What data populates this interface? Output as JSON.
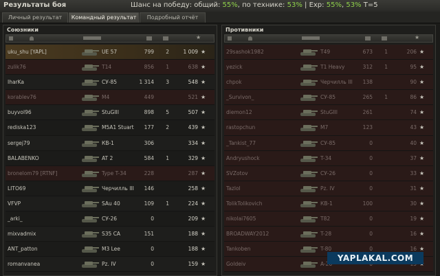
{
  "header": {
    "title": "Результаты боя",
    "chance_label": "Шанс на победу: общий:",
    "chance_overall": "55%",
    "chance_tech_label": ", по технике:",
    "chance_tech": "53%",
    "exp_label": " | Exp:",
    "exp_1": "55%",
    "sep": ",",
    "exp_2": "53%",
    "tier": "T=5"
  },
  "tabs": [
    {
      "label": "Личный результат",
      "active": false
    },
    {
      "label": "Командный результат",
      "active": true
    },
    {
      "label": "Подробный отчёт",
      "active": false
    }
  ],
  "allies": {
    "title": "Союзники",
    "rows": [
      {
        "name": "uku_shu [YAPL]",
        "tank": "UE 57",
        "damage": "799",
        "kills": "2",
        "xp": "1 009",
        "state": "hl"
      },
      {
        "name": "zulik76",
        "tank": "T14",
        "damage": "856",
        "kills": "1",
        "xp": "638",
        "state": "dead"
      },
      {
        "name": "IharKa",
        "tank": "СУ-85",
        "damage": "1 314",
        "kills": "3",
        "xp": "548",
        "state": ""
      },
      {
        "name": "korablev76",
        "tank": "M4",
        "damage": "449",
        "kills": "",
        "xp": "521",
        "state": "dead"
      },
      {
        "name": "buyvol96",
        "tank": "StuGIII",
        "damage": "898",
        "kills": "5",
        "xp": "507",
        "state": ""
      },
      {
        "name": "rediska123",
        "tank": "M5A1 Stuart",
        "damage": "177",
        "kills": "2",
        "xp": "439",
        "state": ""
      },
      {
        "name": "sergej79",
        "tank": "КВ-1",
        "damage": "306",
        "kills": "",
        "xp": "334",
        "state": ""
      },
      {
        "name": "BALABENKO",
        "tank": "AT 2",
        "damage": "584",
        "kills": "1",
        "xp": "329",
        "state": ""
      },
      {
        "name": "bronelom79 [RTNF]",
        "tank": "Type T-34",
        "damage": "228",
        "kills": "",
        "xp": "287",
        "state": "dead"
      },
      {
        "name": "LITO69",
        "tank": "Черчилль III",
        "damage": "146",
        "kills": "",
        "xp": "258",
        "state": ""
      },
      {
        "name": "VFVP",
        "tank": "SAu 40",
        "damage": "109",
        "kills": "1",
        "xp": "224",
        "state": ""
      },
      {
        "name": "_arki_",
        "tank": "СУ-26",
        "damage": "0",
        "kills": "",
        "xp": "209",
        "state": ""
      },
      {
        "name": "mixvadmix",
        "tank": "S35 CA",
        "damage": "151",
        "kills": "",
        "xp": "188",
        "state": ""
      },
      {
        "name": "ANT_patton",
        "tank": "M3 Lee",
        "damage": "0",
        "kills": "",
        "xp": "188",
        "state": ""
      },
      {
        "name": "romanvanea",
        "tank": "Pz. IV",
        "damage": "0",
        "kills": "",
        "xp": "159",
        "state": ""
      }
    ]
  },
  "enemies": {
    "title": "Противники",
    "rows": [
      {
        "name": "29sashok1982",
        "tank": "T49",
        "damage": "673",
        "kills": "1",
        "xp": "206",
        "state": "dead"
      },
      {
        "name": "yezick",
        "tank": "T1 Heavy",
        "damage": "312",
        "kills": "1",
        "xp": "95",
        "state": "dead"
      },
      {
        "name": "chpok",
        "tank": "Черчилль III",
        "damage": "138",
        "kills": "",
        "xp": "90",
        "state": "dead"
      },
      {
        "name": "_Survivon_",
        "tank": "СУ-85",
        "damage": "265",
        "kills": "1",
        "xp": "86",
        "state": "dead"
      },
      {
        "name": "diemon12",
        "tank": "StuGIII",
        "damage": "261",
        "kills": "",
        "xp": "74",
        "state": "dead"
      },
      {
        "name": "rastopchun",
        "tank": "M7",
        "damage": "123",
        "kills": "",
        "xp": "43",
        "state": "dead"
      },
      {
        "name": "_Tankist_77",
        "tank": "СУ-85",
        "damage": "0",
        "kills": "",
        "xp": "40",
        "state": "dead"
      },
      {
        "name": "Andryushock",
        "tank": "T-34",
        "damage": "0",
        "kills": "",
        "xp": "37",
        "state": "dead"
      },
      {
        "name": "SVZotov",
        "tank": "СУ-26",
        "damage": "0",
        "kills": "",
        "xp": "33",
        "state": "dead"
      },
      {
        "name": "Tazlol",
        "tank": "Pz. IV",
        "damage": "0",
        "kills": "",
        "xp": "31",
        "state": "dead"
      },
      {
        "name": "TolikTolikovich",
        "tank": "КВ-1",
        "damage": "100",
        "kills": "",
        "xp": "30",
        "state": "dead"
      },
      {
        "name": "nikolai7605",
        "tank": "T82",
        "damage": "0",
        "kills": "",
        "xp": "19",
        "state": "dead"
      },
      {
        "name": "BROADWAY2012",
        "tank": "T-28",
        "damage": "0",
        "kills": "",
        "xp": "16",
        "state": "dead"
      },
      {
        "name": "Tankoben",
        "tank": "T-80",
        "damage": "0",
        "kills": "",
        "xp": "16",
        "state": "dead"
      },
      {
        "name": "Goldeiv",
        "tank": "A-20",
        "damage": "0",
        "kills": "",
        "xp": "15",
        "state": "dead"
      }
    ]
  },
  "icons": {
    "player": "person-icon",
    "tank": "tank-icon",
    "damage": "damage-icon",
    "kills": "kills-icon",
    "xp": "star-icon"
  },
  "watermark": "YAPLAKAL.COM",
  "colors": {
    "green": "#8fd14a",
    "highlight": "#4a3a20",
    "dead_row": "#2a1a18"
  }
}
